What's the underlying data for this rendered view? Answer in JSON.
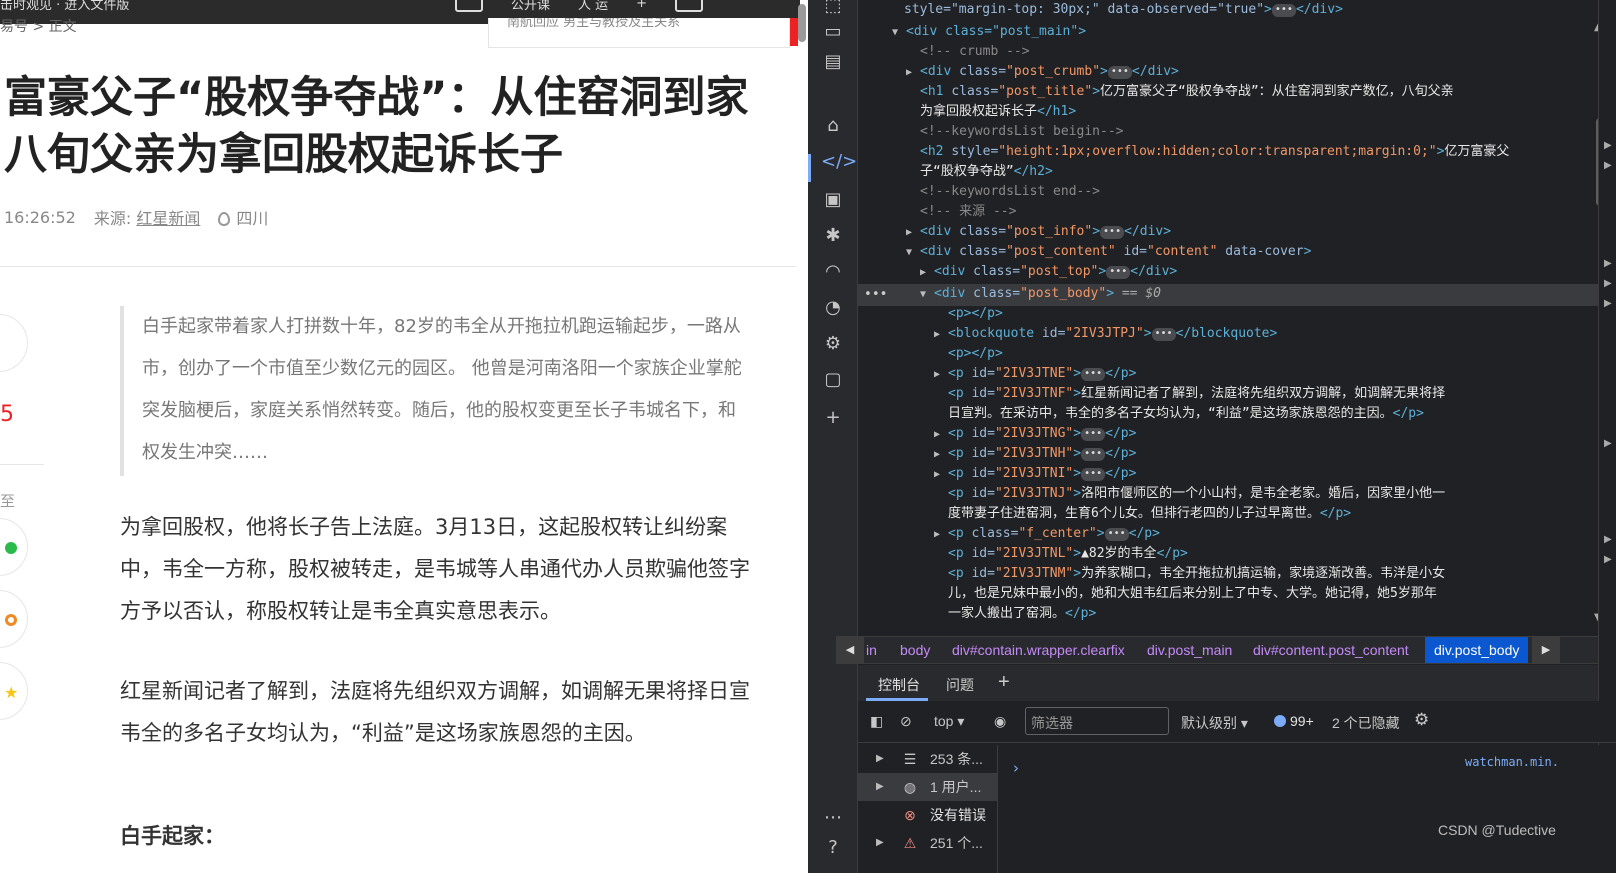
{
  "article": {
    "topbar_left": "击时观见 · 进入文件版",
    "topbar_right": [
      "公开课",
      "人 运",
      "+"
    ],
    "crumb": "易号 > 正文",
    "search_placeholder": "南航回应 男主与教授及主关系",
    "title_lines": [
      "富豪父子“股权争夺战”：从住窑洞到家",
      "八旬父亲为拿回股权起诉长子"
    ],
    "time": "16:26:52",
    "source_label": "来源:",
    "source_name": "红星新闻",
    "location": "四川",
    "side_num": "5",
    "side_zhi": "至",
    "quote_lines": [
      "白手起家带着家人打拼数十年，82岁的韦全从开拖拉机跑运输起步，一路从",
      "市，创办了一个市值至少数亿元的园区。 他曾是河南洛阳一个家族企业掌舵",
      "突发脑梗后，家庭关系悄然转变。随后，他的股权变更至长子韦城名下，和",
      "权发生冲突……"
    ],
    "para1_lines": [
      "为拿回股权，他将长子告上法庭。3月13日，这起股权转让纠纷案",
      "中，韦全一方称，股权被转走，是韦城等人串通代办人员欺骗他签字",
      "方予以否认，称股权转让是韦全真实意思表示。"
    ],
    "para2_lines": [
      "红星新闻记者了解到，法庭将先组织双方调解，如调解无果将择日宣",
      "韦全的多名子女均认为，“利益”是这场家族恩怨的主因。"
    ],
    "subhead": "白手起家："
  },
  "devtools": {
    "lines": {
      "l0_style": "style=\"margin-top: 30px;\"",
      "l0_attr": "data-observed=\"true\"",
      "l1": "div class=\"post_main\"",
      "l2": "<!-- crumb -->",
      "l3_cls": "\"post_crumb\"",
      "l4_cls": "\"post_title\"",
      "l4_text1": "亿万富豪父子“股权争夺战”：从住窑洞到家产数亿，八旬父亲",
      "l4_text2": "为拿回股权起诉长子",
      "l5": "<!--keywordsList beigin-->",
      "l6_style": "\"height:1px;overflow:hidden;color:transparent;margin:0;\"",
      "l6_text1": "亿万富豪父",
      "l6_text2": "子“股权争夺战”",
      "l7": "<!--keywordsList end-->",
      "l8": "<!-- 来源 -->",
      "l9_cls": "\"post_info\"",
      "l10_cls": "\"post_content\"",
      "l10_id": "\"content\"",
      "l10_attr": "data-cover",
      "l11_cls": "\"post_top\"",
      "l12_cls": "\"post_body\"",
      "l12_sel": "== $0",
      "l14_id": "\"2IV3JTPJ\"",
      "l16_id": "\"2IV3JTNE\"",
      "l17_id": "\"2IV3JTNF\"",
      "l17_text1": "红星新闻记者了解到，法庭将先组织双方调解，如调解无果将择",
      "l17_text2": "日宣判。在采访中，韦全的多名子女均认为，“利益”是这场家族恩怨的主因。",
      "l18_id": "\"2IV3JTNG\"",
      "l19_id": "\"2IV3JTNH\"",
      "l20_id": "\"2IV3JTNI\"",
      "l21_id": "\"2IV3JTNJ\"",
      "l21_text1": "洛阳市偃师区的一个小山村，是韦全老家。婚后，因家里小他一",
      "l21_text2": "度带妻子住进窑洞，生育6个儿女。但排行老四的儿子过早离世。",
      "l22_cls": "\"f_center\"",
      "l23_id": "\"2IV3JTNL\"",
      "l23_text": "▲82岁的韦全",
      "l24_id": "\"2IV3JTNM\"",
      "l24_text1": "为养家糊口，韦全开拖拉机搞运输，家境逐渐改善。韦洋是小女",
      "l24_text2": "儿，也是兄妹中最小的，她和大姐韦红后来分别上了中专、大学。她记得，她5岁那年",
      "l24_text3": "一家人搬出了窑洞。"
    },
    "breadcrumbs": [
      "in",
      "body",
      "div#contain.wrapper.clearfix",
      "div.post_main",
      "div#content.post_content",
      "div.post_body"
    ],
    "drawer_tabs": [
      "控制台",
      "问题",
      "+"
    ],
    "console_toolbar": {
      "context": "top",
      "filter_placeholder": "筛选器",
      "level": "默认级别",
      "issues": "99+",
      "hidden": "2 个已隐藏"
    },
    "sidebar": [
      "253 条...",
      "1 用户...",
      "没有错误",
      "251 个..."
    ],
    "source_link": "watchman.min.",
    "prompt": "›"
  },
  "watermark": "CSDN @Tudective",
  "colors": {
    "accent": "#7cacf8",
    "tag": "#5db0d7",
    "attr_value": "#f29766",
    "selected_crumb": "#0b57d0"
  }
}
